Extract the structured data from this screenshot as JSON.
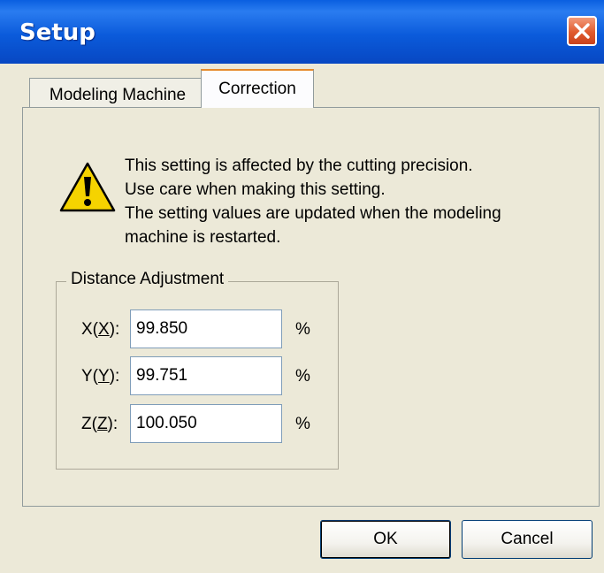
{
  "window": {
    "title": "Setup"
  },
  "tabs": [
    {
      "label": "Modeling Machine",
      "selected": false
    },
    {
      "label": "Correction",
      "selected": true
    }
  ],
  "message": {
    "lines": [
      "This setting is affected by the cutting precision.",
      "Use care when making this setting.",
      "The setting values are updated when the modeling",
      "machine is restarted."
    ]
  },
  "distance_adjustment": {
    "title": "Distance Adjustment",
    "rows": [
      {
        "label_pre": "X(",
        "mnemonic": "X",
        "label_post": "):",
        "value": "99.850",
        "unit": "%"
      },
      {
        "label_pre": "Y(",
        "mnemonic": "Y",
        "label_post": "):",
        "value": "99.751",
        "unit": "%"
      },
      {
        "label_pre": "Z(",
        "mnemonic": "Z",
        "label_post": "):",
        "value": "100.050",
        "unit": "%"
      }
    ]
  },
  "buttons": {
    "ok": "OK",
    "cancel": "Cancel"
  },
  "icons": {
    "close": "close-icon",
    "warning": "warning-icon"
  },
  "colors": {
    "titlebar": "#0b5bdb",
    "close": "#e05a2e",
    "dialog_bg": "#ece9d8",
    "warning_yellow": "#f5d300"
  }
}
